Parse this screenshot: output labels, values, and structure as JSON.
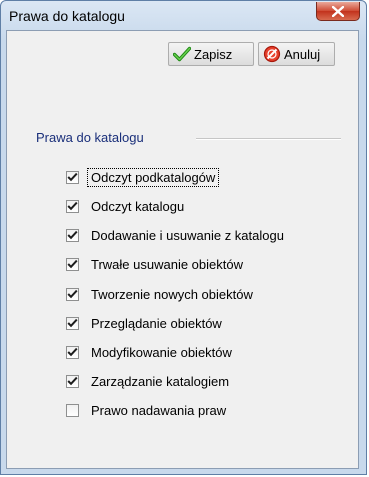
{
  "window": {
    "title": "Prawa do katalogu"
  },
  "toolbar": {
    "save_label": "Zapisz",
    "cancel_label": "Anuluj"
  },
  "group": {
    "title": "Prawa do katalogu",
    "items": [
      {
        "label": "Odczyt podkatalogów",
        "checked": true
      },
      {
        "label": "Odczyt katalogu",
        "checked": true
      },
      {
        "label": "Dodawanie i usuwanie z katalogu",
        "checked": true
      },
      {
        "label": "Trwałe usuwanie obiektów",
        "checked": true
      },
      {
        "label": "Tworzenie nowych obiektów",
        "checked": true
      },
      {
        "label": "Przeglądanie obiektów",
        "checked": true
      },
      {
        "label": "Modyfikowanie obiektów",
        "checked": true
      },
      {
        "label": "Zarządzanie katalogiem",
        "checked": true
      },
      {
        "label": "Prawo nadawania praw",
        "checked": false
      }
    ]
  },
  "colors": {
    "close_button": "#c2321c",
    "group_title": "#1a2f7a",
    "window_border": "#5f7fa6"
  },
  "icons": {
    "close": "close-icon",
    "save": "checkmark-icon",
    "cancel": "cancel-icon"
  }
}
